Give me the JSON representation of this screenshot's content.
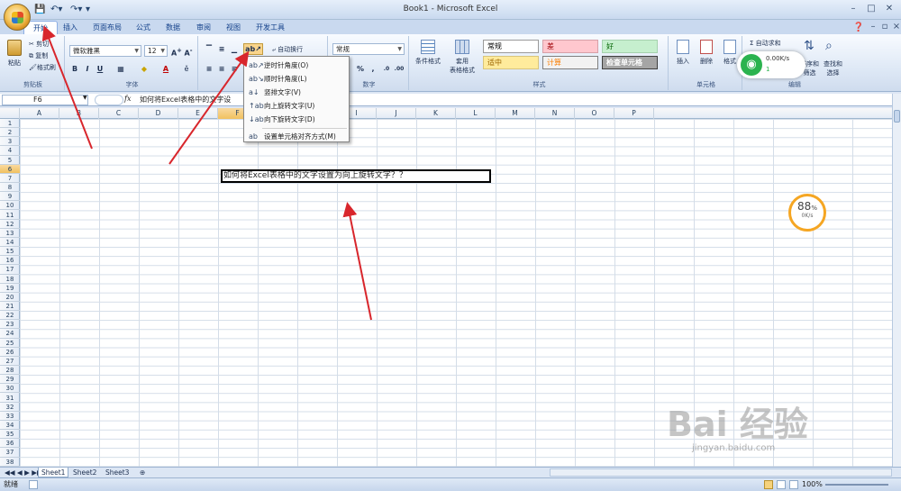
{
  "window": {
    "title": "Book1 - Microsoft Excel",
    "qat_icons": [
      "save-icon",
      "undo-icon",
      "redo-icon"
    ]
  },
  "tabs": [
    "开始",
    "插入",
    "页面布局",
    "公式",
    "数据",
    "审阅",
    "视图",
    "开发工具"
  ],
  "active_tab": "开始",
  "ribbon": {
    "clipboard": {
      "paste": "粘贴",
      "cut": "剪切",
      "copy": "复制",
      "format_painter": "格式刷",
      "label": "剪贴板"
    },
    "font": {
      "name": "微软雅黑",
      "size": "12",
      "label": "字体",
      "bold": "B",
      "italic": "I",
      "underline": "U"
    },
    "alignment": {
      "wrap_text": "自动换行"
    },
    "number": {
      "format": "常规",
      "label": "数字"
    },
    "styles": {
      "label": "样式",
      "conditional_format": "条件格式",
      "table_format_l1": "套用",
      "table_format_l2": "表格格式",
      "cells": [
        {
          "text": "常规",
          "bg": "#ffffff",
          "fg": "#000000",
          "border": "#9a9a9a"
        },
        {
          "text": "差",
          "bg": "#ffc7ce",
          "fg": "#9c0006",
          "border": "#d7a0a8"
        },
        {
          "text": "好",
          "bg": "#c6efce",
          "fg": "#006100",
          "border": "#a5d1ae"
        },
        {
          "text": "适中",
          "bg": "#ffeb9c",
          "fg": "#9c6500",
          "border": "#d9c47c"
        },
        {
          "text": "计算",
          "bg": "#f2f2f2",
          "fg": "#fa7d00",
          "border": "#7f7f7f"
        },
        {
          "text": "检查单元格",
          "bg": "#a5a5a5",
          "fg": "#ffffff",
          "border": "#3f3f3f"
        }
      ]
    },
    "cells_group": {
      "insert": "插入",
      "delete": "删除",
      "format": "格式",
      "label": "单元格"
    },
    "editing": {
      "autosum": "Σ 自动求和",
      "sort_filter_l1": "排序和",
      "sort_filter_l2": "筛选",
      "find_l1": "查找和",
      "find_l2": "选择",
      "label": "编辑"
    }
  },
  "orientation_menu": {
    "items": [
      "逆时针角度(O)",
      "顺时针角度(L)",
      "竖排文字(V)",
      "向上旋转文字(U)",
      "向下旋转文字(D)",
      "设置单元格对齐方式(M)"
    ]
  },
  "formula_bar": {
    "name_box": "F6",
    "fx": "fx",
    "content": "如何将Excel表格中的文字设"
  },
  "grid": {
    "columns": [
      "A",
      "B",
      "C",
      "D",
      "E",
      "F",
      "G",
      "H",
      "I",
      "J",
      "K",
      "L",
      "M",
      "N",
      "O",
      "P"
    ],
    "selected_column": "F",
    "rows": [
      "1",
      "2",
      "3",
      "4",
      "5",
      "6",
      "7",
      "8",
      "9",
      "10",
      "11",
      "12",
      "13",
      "14",
      "15",
      "16",
      "17",
      "18",
      "19",
      "20",
      "21",
      "22",
      "23",
      "24",
      "25",
      "26",
      "27",
      "28",
      "29",
      "30",
      "31",
      "32",
      "33",
      "34",
      "35",
      "36",
      "37",
      "38"
    ],
    "selected_row": "6",
    "active_cell_text": "如何将Excel表格中的文字设置为向上旋转文字？？"
  },
  "sheets": [
    "Sheet1",
    "Sheet2",
    "Sheet3"
  ],
  "active_sheet": "Sheet1",
  "status": {
    "ready": "就绪",
    "zoom": "100%"
  },
  "overlays": {
    "wifi_speed": "0.00K/s",
    "wifi_count": "1",
    "gauge_percent": "88",
    "gauge_unit": "%",
    "gauge_speed": "0K/s",
    "watermark": "Bai 经验",
    "watermark_sub": "jingyan.baidu.com"
  }
}
